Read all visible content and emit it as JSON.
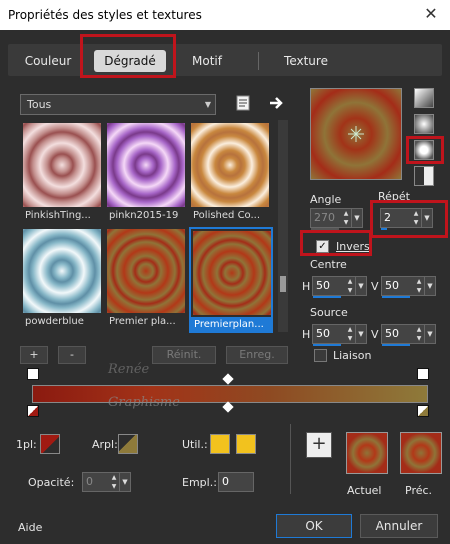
{
  "window": {
    "title": "Propriétés des styles et textures",
    "close": "✕"
  },
  "tabs": [
    {
      "label": "Couleur"
    },
    {
      "label": "Dégradé"
    },
    {
      "label": "Motif"
    },
    {
      "label": "Texture"
    }
  ],
  "library": {
    "category": "Tous",
    "items": [
      {
        "label": "PinkishTing...",
        "colors": [
          "#c28e8c",
          "#f3dede",
          "#9a5050"
        ]
      },
      {
        "label": "pinkn2015-19",
        "colors": [
          "#a766c8",
          "#f5d8f7",
          "#7a3a8a"
        ]
      },
      {
        "label": "Polished Co...",
        "colors": [
          "#c9883f",
          "#fbeedd",
          "#b7723d"
        ]
      },
      {
        "label": "powderblue",
        "colors": [
          "#88b8c8",
          "#f2f8fa",
          "#5f8fa6"
        ]
      },
      {
        "label": "Premier pla...",
        "colors": [
          "#8f7438",
          "#b23818",
          "#a42c18"
        ]
      },
      {
        "label": "Premierplan...",
        "colors": [
          "#8f7438",
          "#b23818",
          "#a42c18"
        ]
      }
    ],
    "add": "+",
    "remove": "-",
    "reset": "Réinit.",
    "save": "Enreg."
  },
  "params": {
    "angle_label": "Angle",
    "angle_value": "270",
    "repeat_label": "Répét",
    "repeat_value": "2",
    "invert_label": "Invers",
    "invert_checked": true,
    "center_label": "Centre",
    "center_h_label": "H",
    "center_h": "50",
    "center_v_label": "V",
    "center_v": "50",
    "source_label": "Source",
    "source_h_label": "H",
    "source_h": "50",
    "source_v_label": "V",
    "source_v": "50",
    "link_label": "Liaison"
  },
  "editor": {
    "watermark_line1": "Renée",
    "watermark_line2": "Graphisme",
    "fg_label": "1pl:",
    "fg_color": "#a01a12",
    "bg_label": "Arpl:",
    "util_label": "Util.:",
    "util_color1": "#f2c21e",
    "util_color2": "#f2c21e",
    "opacity_label": "Opacité:",
    "opacity_value": "0",
    "empl_label": "Empl.:",
    "empl_value": "0"
  },
  "compare": {
    "add": "+",
    "current_label": "Actuel",
    "previous_label": "Préc."
  },
  "footer": {
    "help": "Aide",
    "ok": "OK",
    "cancel": "Annuler"
  },
  "colors": {
    "accent": "#1f7ad6",
    "highlight_box": "#c0141c",
    "gradient_start": "#8b1a10",
    "gradient_end": "#8e7a3a"
  }
}
